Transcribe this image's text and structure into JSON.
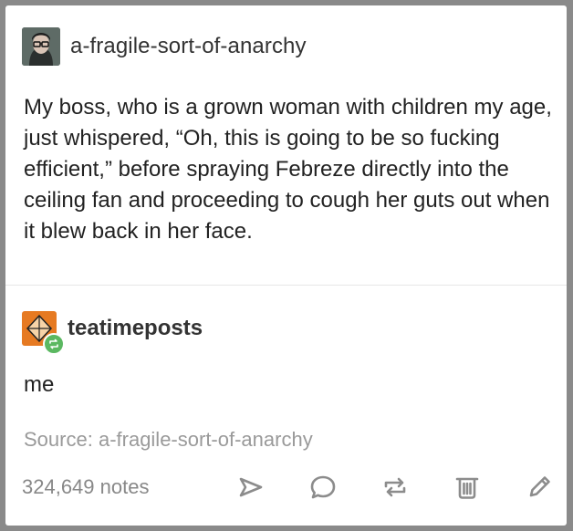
{
  "post": {
    "username": "a-fragile-sort-of-anarchy",
    "text": "My boss, who is a grown woman with children my age, just whispered, “Oh, this is going to be so fucking efficient,” before spraying Febreze directly into the ceiling fan and proceeding to cough her guts out when it blew back in her face."
  },
  "reblog": {
    "username": "teatimeposts",
    "text": "me"
  },
  "source": {
    "label": "Source:",
    "name": "a-fragile-sort-of-anarchy"
  },
  "footer": {
    "notes": "324,649 notes"
  },
  "icons": {
    "share": "share-icon",
    "reply": "reply-icon",
    "reblog": "reblog-icon",
    "delete": "delete-icon",
    "edit": "edit-icon"
  },
  "colors": {
    "reblog_badge": "#5bb861",
    "avatar_orange": "#e67a22",
    "icon_gray": "#8c8c8c"
  }
}
